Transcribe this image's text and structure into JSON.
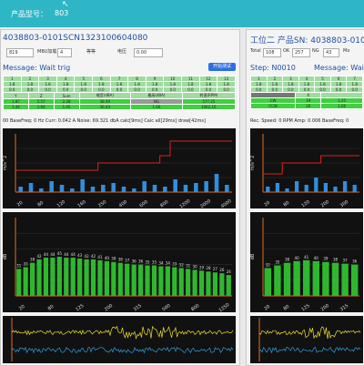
{
  "header": {
    "label": "产品型号：",
    "value": "803"
  },
  "left": {
    "serial": "4038803-0101SCN1323100604080",
    "fields": [
      {
        "label": "",
        "value": "819"
      },
      {
        "label": "MBU加载",
        "value": "4"
      },
      {
        "label": "等等",
        "value": ""
      },
      {
        "label": "电压",
        "value": "0.00"
      }
    ],
    "message": "Message: Wait trig",
    "button": "开始测试",
    "table_head": [
      "1",
      "2",
      "3",
      "4",
      "5",
      "6",
      "7",
      "8",
      "9",
      "10",
      "11",
      "12",
      "13"
    ],
    "table_rows": [
      [
        "1.8",
        "1.8",
        "1.8",
        "1.8",
        "1.8",
        "1.8",
        "1.8",
        "1.8",
        "1.8",
        "1.8",
        "1.8",
        "1.8",
        "1.8"
      ],
      [
        "0.0",
        "0.0",
        "0.0",
        "0.0",
        "0.0",
        "0.0",
        "0.0",
        "0.0",
        "0.0",
        "0.0",
        "0.0",
        "0.0",
        "0.0"
      ]
    ],
    "result_head": [
      "Y",
      "Z",
      "Sum",
      "噪音(dBA)",
      "最高(dBA)",
      "转速(RPM)"
    ],
    "result_row1": [
      "1.87",
      "5.57",
      "2.28",
      "38.49",
      "NG",
      "577.25"
    ],
    "result_row2": [
      "1.44",
      "1.94",
      "1.05",
      "36.44",
      "1.66",
      "1062.16"
    ],
    "status": "00  BaseFreq: 0 Hz  Curr: 0.042 A  Noise: 69.321 dbA calc[9ms] Calc all[29ms] draw[42ms]"
  },
  "right": {
    "station": "工位二",
    "serial_label": "产品SN:",
    "serial": "4038803-0101S",
    "fields": [
      {
        "label": "Total",
        "value": "108"
      },
      {
        "label": "OK",
        "value": "257"
      },
      {
        "label": "NG",
        "value": "43"
      },
      {
        "label": "Mo",
        "value": ""
      }
    ],
    "step": "Step: N0010",
    "message": "Message: Wait tr",
    "dir_head": [
      "",
      "X"
    ],
    "dir_rows": [
      [
        "CW",
        "19"
      ],
      [
        "CCW",
        "20"
      ]
    ],
    "dir_vals": [
      "1.25",
      "1.06"
    ],
    "status": "Rec.   Speed: 0 RPM   Amp: 0.006   BaseFreq: 0"
  },
  "chart_data": [
    {
      "type": "bar",
      "title": "",
      "ylabel": "m/s^2",
      "categories": [
        "20",
        "63",
        "80",
        "100",
        "120",
        "150",
        "160",
        "200",
        "250",
        "300",
        "400",
        "500",
        "600",
        "700",
        "800",
        "1000",
        "1200",
        "1600",
        "2000",
        "2500",
        "4000"
      ],
      "values": [
        0.3,
        0.5,
        0.2,
        0.6,
        0.4,
        0.2,
        0.7,
        0.3,
        0.4,
        0.5,
        0.3,
        0.2,
        0.6,
        0.4,
        0.3,
        0.7,
        0.4,
        0.5,
        0.6,
        1.0,
        0.4
      ],
      "limit": [
        1.2,
        1.2,
        1.2,
        1.2,
        1.2,
        1.2,
        1.2,
        1.2,
        1.6,
        1.6,
        1.6,
        1.6,
        1.6,
        1.6,
        2.0,
        2.8,
        2.8,
        2.8,
        2.8,
        2.8,
        2.8
      ]
    },
    {
      "type": "bar",
      "title": "",
      "ylabel": "dB",
      "categories": [
        "20",
        "50",
        "80",
        "100",
        "125",
        "160",
        "200",
        "250",
        "315",
        "400",
        "500",
        "630",
        "800",
        "1000",
        "1250"
      ],
      "values": [
        31,
        33,
        38,
        42,
        44,
        44,
        45,
        44,
        44,
        43,
        42,
        42,
        41,
        40,
        39,
        38,
        37,
        36,
        36,
        35,
        35,
        34,
        34,
        33,
        32,
        31,
        30,
        29,
        28,
        27,
        26,
        24
      ],
      "labels": [
        "31",
        "33",
        "38",
        "42",
        "44",
        "44",
        "45",
        "44",
        "44",
        "43",
        "42",
        "42",
        "41",
        "40",
        "39",
        "38",
        "37",
        "36",
        "36",
        "35",
        "35",
        "34",
        "34",
        "33",
        "32",
        "31",
        "30",
        "29",
        "28",
        "27",
        "26",
        "24"
      ]
    },
    {
      "type": "bar",
      "title": "",
      "ylabel": "m/s^2",
      "categories": [
        "20",
        "50",
        "80",
        "100",
        "120",
        "160",
        "200",
        "250",
        "300",
        "400"
      ],
      "values": [
        0.3,
        0.5,
        0.2,
        0.6,
        0.4,
        0.8,
        0.5,
        0.3,
        0.6,
        0.4
      ],
      "limit": [
        1.0,
        1.0,
        1.6,
        1.6,
        1.6,
        1.6,
        2.0,
        2.0,
        2.0,
        2.0
      ]
    },
    {
      "type": "bar",
      "title": "",
      "ylabel": "dB",
      "categories": [
        "20",
        "50",
        "80",
        "100",
        "125",
        "160",
        "200",
        "250",
        "315",
        "400"
      ],
      "values": [
        32,
        35,
        38,
        40,
        41,
        40,
        39,
        38,
        37,
        36
      ],
      "labels": [
        "32",
        "35",
        "38",
        "40",
        "41",
        "40",
        "39",
        "38",
        "37",
        "36"
      ]
    }
  ]
}
